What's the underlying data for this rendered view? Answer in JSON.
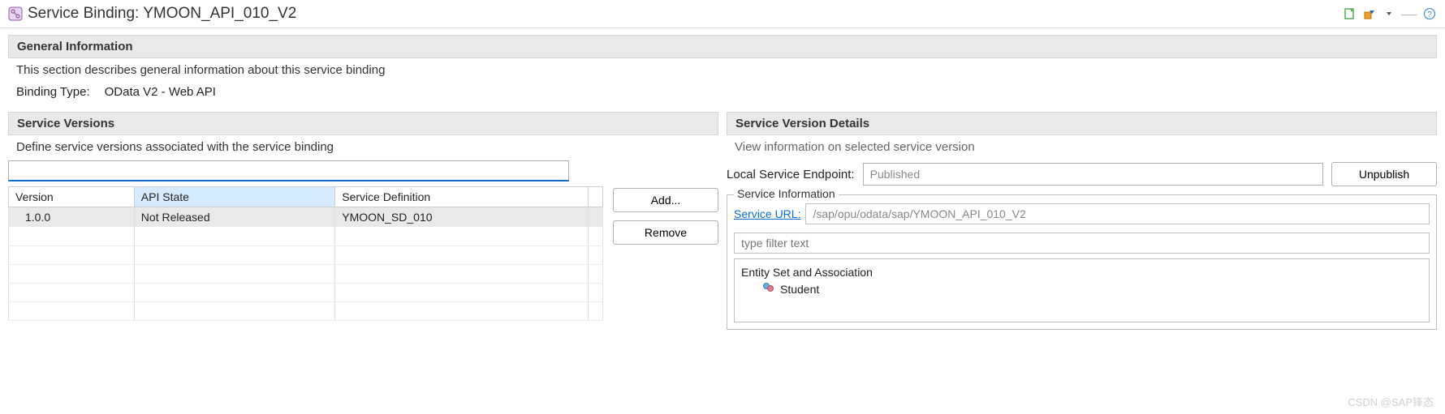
{
  "header": {
    "title": "Service Binding: YMOON_API_010_V2"
  },
  "general": {
    "section_title": "General Information",
    "description": "This section describes general information about this service binding",
    "binding_type_label": "Binding Type:",
    "binding_type_value": "OData V2 - Web API"
  },
  "versions": {
    "section_title": "Service Versions",
    "description": "Define service versions associated with the service binding",
    "filter_value": "",
    "columns": {
      "version": "Version",
      "api_state": "API State",
      "service_def": "Service Definition"
    },
    "rows": [
      {
        "version": "1.0.0",
        "api_state": "Not Released",
        "service_def": "YMOON_SD_010"
      }
    ],
    "buttons": {
      "add": "Add...",
      "remove": "Remove"
    }
  },
  "details": {
    "section_title": "Service Version Details",
    "description": "View information on selected service version",
    "endpoint_label": "Local Service Endpoint:",
    "endpoint_value": "Published",
    "unpublish": "Unpublish",
    "service_info_legend": "Service Information",
    "service_url_label": "Service URL:",
    "service_url_value": "/sap/opu/odata/sap/YMOON_API_010_V2",
    "tree_filter_placeholder": "type filter text",
    "tree_root": "Entity Set and Association",
    "tree_children": [
      "Student"
    ]
  },
  "watermark": "CSDN @SAP锋态"
}
